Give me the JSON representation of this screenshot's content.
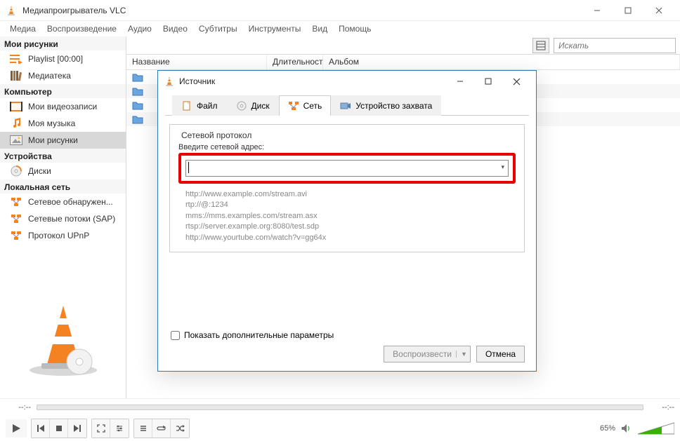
{
  "window": {
    "title": "Медиапроигрыватель VLC"
  },
  "menu": {
    "items": [
      "Медиа",
      "Воспроизведение",
      "Аудио",
      "Видео",
      "Субтитры",
      "Инструменты",
      "Вид",
      "Помощь"
    ]
  },
  "sidebar": {
    "sections": [
      {
        "title": "Мои рисунки",
        "items": [
          {
            "label": "Playlist [00:00]",
            "icon": "playlist"
          },
          {
            "label": "Медиатека",
            "icon": "library"
          }
        ]
      },
      {
        "title": "Компьютер",
        "items": [
          {
            "label": "Мои видеозаписи",
            "icon": "video"
          },
          {
            "label": "Моя музыка",
            "icon": "music"
          },
          {
            "label": "Мои рисунки",
            "icon": "pictures",
            "selected": true
          }
        ]
      },
      {
        "title": "Устройства",
        "items": [
          {
            "label": "Диски",
            "icon": "disc"
          }
        ]
      },
      {
        "title": "Локальная сеть",
        "items": [
          {
            "label": "Сетевое обнаружен...",
            "icon": "network"
          },
          {
            "label": "Сетевые потоки (SAP)",
            "icon": "network"
          },
          {
            "label": "Протокол UPnP",
            "icon": "network"
          }
        ]
      }
    ]
  },
  "main": {
    "columns": {
      "name": "Название",
      "duration": "Длительност",
      "album": "Альбом"
    },
    "search_placeholder": "Искать"
  },
  "dialog": {
    "title": "Источник",
    "tabs": {
      "file": "Файл",
      "disc": "Диск",
      "network": "Сеть",
      "capture": "Устройство захвата"
    },
    "network": {
      "group_label": "Сетевой протокол",
      "prompt": "Введите сетевой адрес:",
      "value": "",
      "examples": [
        "http://www.example.com/stream.avi",
        "rtp://@:1234",
        "mms://mms.examples.com/stream.asx",
        "rtsp://server.example.org:8080/test.sdp",
        "http://www.yourtube.com/watch?v=gg64x"
      ]
    },
    "more_options": "Показать дополнительные параметры",
    "play": "Воспроизвести",
    "cancel": "Отмена"
  },
  "player": {
    "time_left": "--:--",
    "time_right": "--:--",
    "volume_pct": "65%"
  }
}
